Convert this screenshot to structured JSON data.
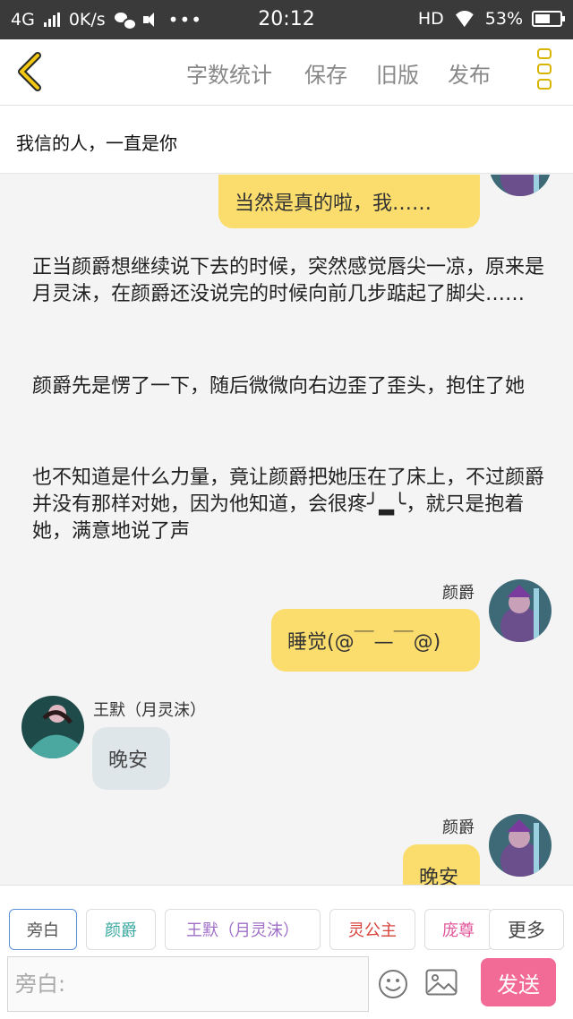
{
  "status_bar": {
    "network": "4G",
    "speed": "0K/s",
    "time": "20:12",
    "hd": "HD",
    "battery": "53%",
    "icons": [
      "signal-icon",
      "wechat-icon",
      "speaker-icon",
      "more-dots-icon",
      "wifi-icon",
      "battery-icon"
    ]
  },
  "toolbar": {
    "word_count": "字数统计",
    "save": "保存",
    "old_version": "旧版",
    "publish": "发布",
    "accent_color": "#f2c811"
  },
  "chapter_title": "我信的人，一直是你",
  "messages": {
    "m1_text": "当然是真的啦，我……",
    "n1": "正当颜爵想继续说下去的时候，突然感觉唇尖一凉，原来是月灵沫，在颜爵还没说完的时候向前几步踮起了脚尖……",
    "n2": "颜爵先是愣了一下，随后微微向右边歪了歪头，抱住了她",
    "n3a": "也不知道是什么力量，竟让颜爵把她压在了床上，不过颜爵并没有那样对她，因为他知道，会很疼",
    "n3b": "╯▂╰，就只是抱着她，满意地说了声",
    "m2_sender": "颜爵",
    "m2_text": "睡觉(@￣—￣@)",
    "m3_sender": "王默（月灵沫）",
    "m3_text": "晚安",
    "m4_sender": "颜爵",
    "m4_text": "晚安"
  },
  "roles": {
    "narrator": "旁白",
    "yanjue": "颜爵",
    "wangmo": "王默（月灵沫）",
    "linggongzhu": "灵公主",
    "pangzun": "庞尊",
    "more": "更多"
  },
  "role_colors": {
    "narrator": "#555555",
    "yanjue": "#3aa8a0",
    "wangmo": "#a070c8",
    "linggongzhu": "#d8423c",
    "pangzun": "#e0559a"
  },
  "input": {
    "placeholder": "旁白:",
    "send": "发送",
    "send_color": "#f26a96"
  }
}
